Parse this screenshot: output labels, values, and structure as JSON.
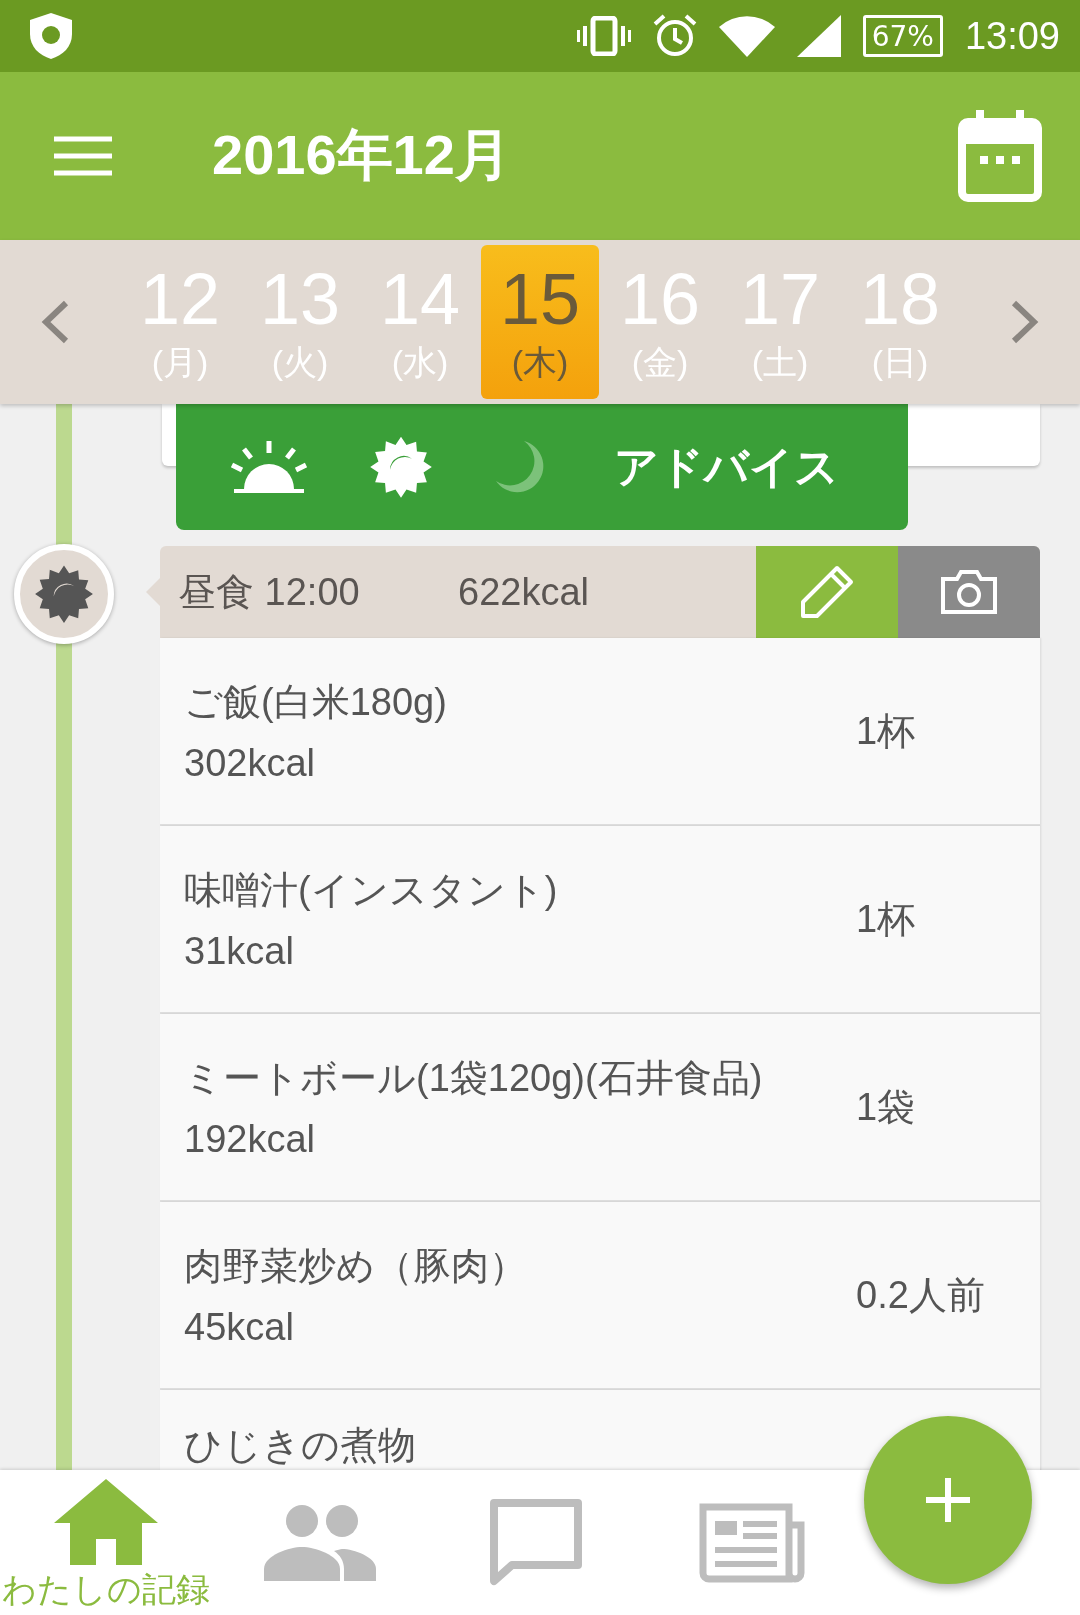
{
  "status_bar": {
    "battery": "67%",
    "time": "13:09"
  },
  "app_bar": {
    "title": "2016年12月"
  },
  "days": [
    {
      "date": "12",
      "weekday": "(月)",
      "selected": false
    },
    {
      "date": "13",
      "weekday": "(火)",
      "selected": false
    },
    {
      "date": "14",
      "weekday": "(水)",
      "selected": false
    },
    {
      "date": "15",
      "weekday": "(木)",
      "selected": true
    },
    {
      "date": "16",
      "weekday": "(金)",
      "selected": false
    },
    {
      "date": "17",
      "weekday": "(土)",
      "selected": false
    },
    {
      "date": "18",
      "weekday": "(日)",
      "selected": false
    }
  ],
  "advice": {
    "label": "アドバイス"
  },
  "meal": {
    "title": "昼食 12:00",
    "calories": "622kcal"
  },
  "foods": [
    {
      "name": "ご飯(白米180g)",
      "calories": "302kcal",
      "amount": "1杯"
    },
    {
      "name": "味噌汁(インスタント)",
      "calories": "31kcal",
      "amount": "1杯"
    },
    {
      "name": "ミートボール(1袋120g)(石井食品)",
      "calories": "192kcal",
      "amount": "1袋"
    },
    {
      "name": "肉野菜炒め（豚肉）",
      "calories": "45kcal",
      "amount": "0.2人前"
    },
    {
      "name": "ひじきの煮物"
    }
  ],
  "bottom_nav": [
    {
      "kind": "home",
      "label": "わたしの記録",
      "selected": true
    },
    {
      "kind": "people",
      "selected": false
    },
    {
      "kind": "chat",
      "selected": false
    },
    {
      "kind": "news",
      "selected": false
    }
  ]
}
